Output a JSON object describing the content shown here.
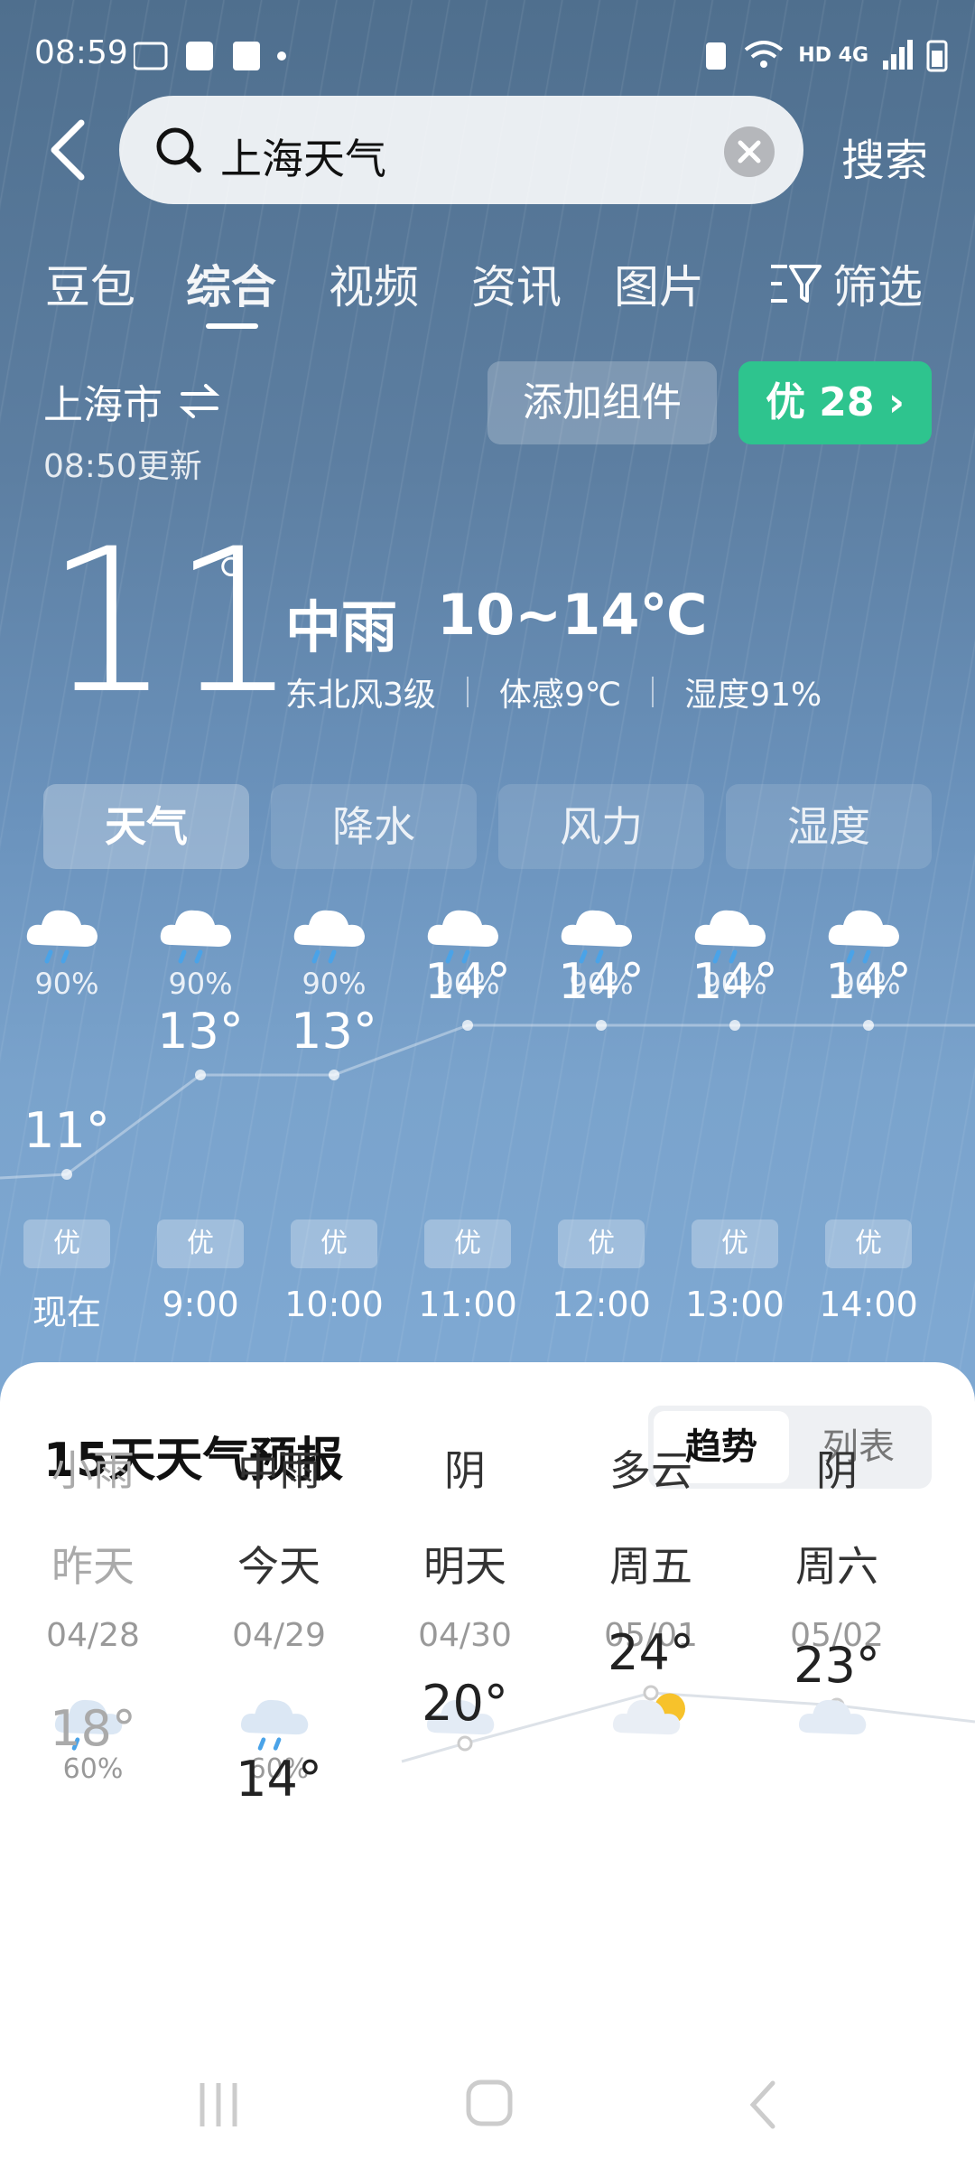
{
  "status": {
    "time": "08:59",
    "network": "HD 4G"
  },
  "search": {
    "query": "上海天气",
    "button": "搜索"
  },
  "tabs": [
    "豆包",
    "综合",
    "视频",
    "资讯",
    "图片",
    "筛选"
  ],
  "location": {
    "city": "上海市",
    "update": "08:50更新",
    "add_widget": "添加组件",
    "aqi": "优 28"
  },
  "current": {
    "temp": "11",
    "degree": "°",
    "condition": "中雨",
    "range": "10~14℃",
    "wind": "东北风3级",
    "feels": "体感9℃",
    "humidity": "湿度91%"
  },
  "modes": [
    "天气",
    "降水",
    "风力",
    "湿度"
  ],
  "hourly": [
    {
      "prob": "90%",
      "temp": "11°",
      "aqi": "优",
      "time": "现在",
      "value": 11
    },
    {
      "prob": "90%",
      "temp": "13°",
      "aqi": "优",
      "time": "9:00",
      "value": 13
    },
    {
      "prob": "90%",
      "temp": "13°",
      "aqi": "优",
      "time": "10:00",
      "value": 13
    },
    {
      "prob": "90%",
      "temp": "14°",
      "aqi": "优",
      "time": "11:00",
      "value": 14
    },
    {
      "prob": "90%",
      "temp": "14°",
      "aqi": "优",
      "time": "12:00",
      "value": 14
    },
    {
      "prob": "90%",
      "temp": "14°",
      "aqi": "优",
      "time": "13:00",
      "value": 14
    },
    {
      "prob": "90%",
      "temp": "14°",
      "aqi": "优",
      "time": "14:00",
      "value": 14
    }
  ],
  "forecast": {
    "title": "15天天气预报",
    "toggle": [
      "趋势",
      "列表"
    ],
    "days": [
      {
        "name": "昨天",
        "date": "04/28",
        "prob": "60%",
        "cond": "小雨",
        "high": "18°",
        "value": 18,
        "icon": "rain-light-icon"
      },
      {
        "name": "今天",
        "date": "04/29",
        "prob": "60%",
        "cond": "中雨",
        "high": "14°",
        "value": 14,
        "icon": "rain-moderate-icon"
      },
      {
        "name": "明天",
        "date": "04/30",
        "prob": "",
        "cond": "阴",
        "high": "20°",
        "value": 20,
        "icon": "overcast-icon"
      },
      {
        "name": "周五",
        "date": "05/01",
        "prob": "",
        "cond": "多云",
        "high": "24°",
        "value": 24,
        "icon": "partly-cloudy-icon"
      },
      {
        "name": "周六",
        "date": "05/02",
        "prob": "",
        "cond": "阴",
        "high": "23°",
        "value": 23,
        "icon": "overcast-icon"
      }
    ]
  }
}
